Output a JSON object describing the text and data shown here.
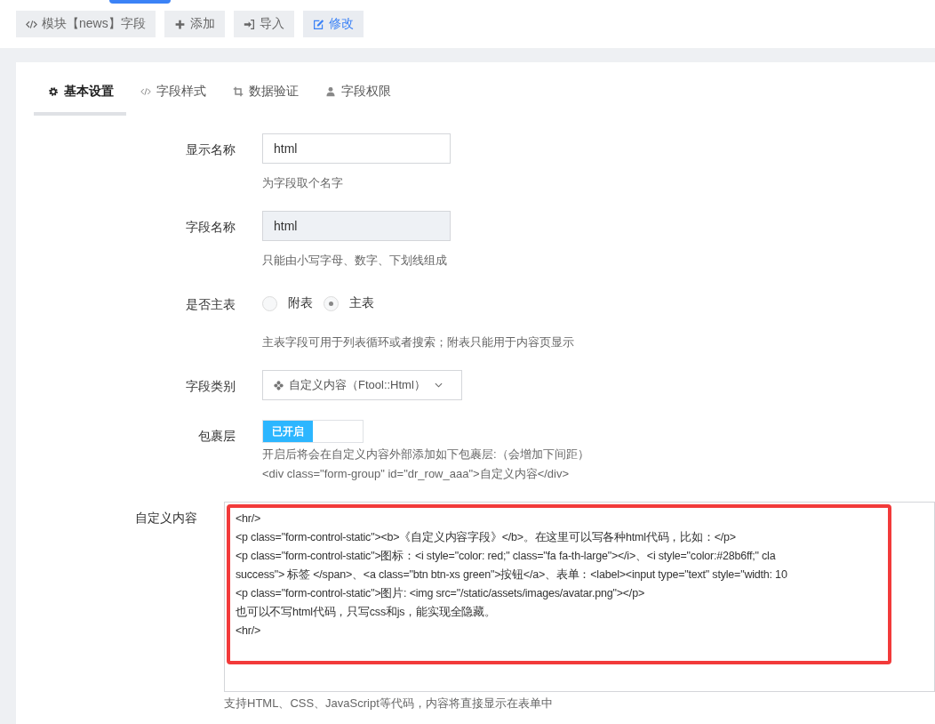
{
  "toolbar": [
    {
      "kind": "code",
      "label": "模块【news】字段",
      "selected": false
    },
    {
      "kind": "plus",
      "label": "添加",
      "selected": false
    },
    {
      "kind": "import",
      "label": "导入",
      "selected": false
    },
    {
      "kind": "edit",
      "label": "修改",
      "selected": true
    }
  ],
  "tabs": [
    {
      "kind": "gear",
      "label": "基本设置",
      "selected": true
    },
    {
      "kind": "code",
      "label": "字段样式",
      "selected": false
    },
    {
      "kind": "crop",
      "label": "数据验证",
      "selected": false
    },
    {
      "kind": "user",
      "label": "字段权限",
      "selected": false
    }
  ],
  "form": {
    "display_name": {
      "label": "显示名称",
      "value": "html",
      "help": "为字段取个名字"
    },
    "field_name": {
      "label": "字段名称",
      "value": "html",
      "disabled": true,
      "help": "只能由小写字母、数字、下划线组成"
    },
    "main_table": {
      "label": "是否主表",
      "options": [
        {
          "label": "附表",
          "selected": false
        },
        {
          "label": "主表",
          "selected": true
        }
      ],
      "help": "主表字段可用于列表循环或者搜索；附表只能用于内容页显示"
    },
    "field_type": {
      "label": "字段类别",
      "value": "自定义内容（Ftool::Html）"
    },
    "wrapper": {
      "label": "包裹层",
      "on": true,
      "switch_label": "已开启",
      "help": [
        "开启后将会在自定义内容外部添加如下包裹层:（会增加下间距）",
        "<div class=\"form-group\" id=\"dr_row_aaa\">自定义内容</div>"
      ]
    },
    "custom_content": {
      "label": "自定义内容",
      "lines": [
        "<hr/>",
        "<p class=\"form-control-static\"><b>《自定义内容字段》</b>。在这里可以写各种html代码，比如：</p>",
        "<p class=\"form-control-static\">图标：<i style=\"color: red;\" class=\"fa fa-th-large\"></i>、<i style=\"color:#28b6ff;\" cla",
        "success\"> 标签 </span>、<a class=\"btn btn-xs green\">按钮</a>、表单：<label><input type=\"text\" style=\"width: 10",
        "<p class=\"form-control-static\">图片: <img src=\"/static/assets/images/avatar.png\"></p>",
        "也可以不写html代码，只写css和js，能实现全隐藏。",
        "<hr/>"
      ],
      "help": "支持HTML、CSS、JavaScript等代码，内容将直接显示在表单中"
    }
  }
}
